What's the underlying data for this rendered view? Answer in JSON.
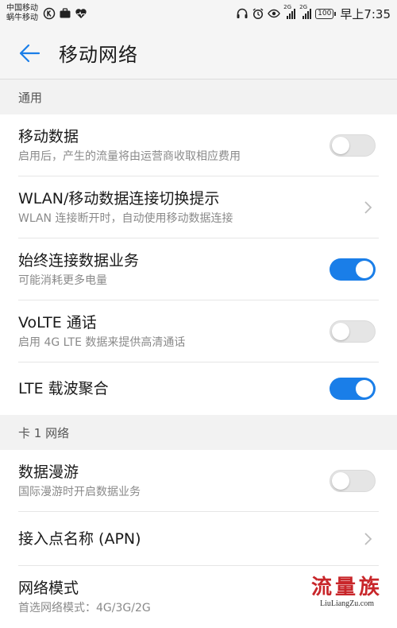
{
  "status_bar": {
    "carrier_1": "中国移动",
    "carrier_2": "蜗牛移动",
    "signal_1_label": "2G",
    "signal_2_label": "2G",
    "battery": "100",
    "time": "早上7:35",
    "left_icons": [
      "k-circle-icon",
      "briefcase-icon",
      "heart-pulse-icon"
    ],
    "right_icons": [
      "headset-icon",
      "alarm-icon",
      "eye-icon",
      "signal-icon",
      "signal-icon",
      "battery-icon"
    ]
  },
  "title_bar": {
    "title": "移动网络"
  },
  "sections": {
    "general": {
      "header": "通用",
      "items": [
        {
          "title": "移动数据",
          "subtitle": "启用后，产生的流量将由运营商收取相应费用",
          "control": "toggle",
          "checked": false
        },
        {
          "title": "WLAN/移动数据连接切换提示",
          "subtitle": "WLAN 连接断开时，自动使用移动数据连接",
          "control": "chevron"
        },
        {
          "title": "始终连接数据业务",
          "subtitle": "可能消耗更多电量",
          "control": "toggle",
          "checked": true
        },
        {
          "title": "VoLTE 通话",
          "subtitle": "启用 4G LTE 数据来提供高清通话",
          "control": "toggle",
          "checked": false
        },
        {
          "title": "LTE 载波聚合",
          "control": "toggle",
          "checked": true
        }
      ]
    },
    "sim1": {
      "header": "卡 1 网络",
      "items": [
        {
          "title": "数据漫游",
          "subtitle": "国际漫游时开启数据业务",
          "control": "toggle",
          "checked": false
        },
        {
          "title": "接入点名称 (APN)",
          "control": "chevron"
        },
        {
          "title": "网络模式",
          "subtitle": "首选网络模式：4G/3G/2G"
        }
      ]
    }
  },
  "watermark": {
    "cn": "流量族",
    "en": "LiuLiangZu.com"
  },
  "colors": {
    "accent": "#1a7ee8",
    "back_arrow": "#1a7ee8",
    "watermark_red": "#c8262a"
  }
}
